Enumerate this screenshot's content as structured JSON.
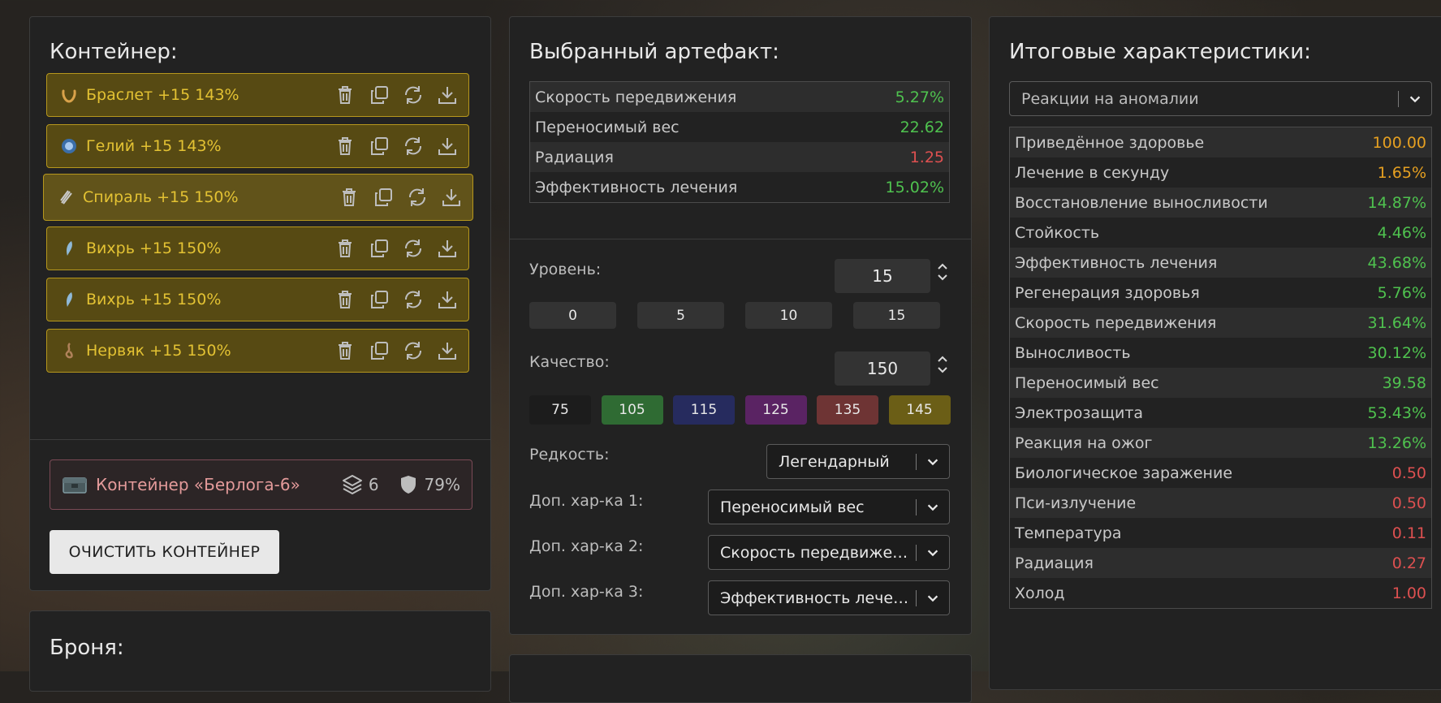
{
  "container_panel": {
    "title": "Контейнер:",
    "artifacts": [
      {
        "name": "Браслет +15 143%",
        "icon": "bracelet-artifact-icon"
      },
      {
        "name": "Гелий +15 143%",
        "icon": "helium-artifact-icon"
      },
      {
        "name": "Спираль +15 150%",
        "icon": "spiral-artifact-icon"
      },
      {
        "name": "Вихрь +15 150%",
        "icon": "vortex-artifact-icon"
      },
      {
        "name": "Вихрь +15 150%",
        "icon": "vortex-artifact-icon"
      },
      {
        "name": "Нервяк +15 150%",
        "icon": "nervyak-artifact-icon"
      }
    ],
    "container": {
      "name": "Контейнер «Берлога-6»",
      "slots": "6",
      "protection": "79%"
    },
    "clear_button": "ОЧИСТИТЬ КОНТЕЙНЕР"
  },
  "armor_panel": {
    "title": "Броня:"
  },
  "selected_panel": {
    "title": "Выбранный артефакт:",
    "stats": [
      {
        "name": "Скорость передвижения",
        "value": "5.27%",
        "color": "green"
      },
      {
        "name": "Переносимый вес",
        "value": "22.62",
        "color": "green"
      },
      {
        "name": "Радиация",
        "value": "1.25",
        "color": "red"
      },
      {
        "name": "Эффективность лечения",
        "value": "15.02%",
        "color": "green"
      }
    ],
    "level_label": "Уровень:",
    "level_value": "15",
    "level_presets": [
      "0",
      "5",
      "10",
      "15"
    ],
    "quality_label": "Качество:",
    "quality_value": "150",
    "quality_presets": [
      {
        "label": "75",
        "color": "#1c1c1c"
      },
      {
        "label": "105",
        "color": "#2f6b33"
      },
      {
        "label": "115",
        "color": "#262b5e"
      },
      {
        "label": "125",
        "color": "#5a2363"
      },
      {
        "label": "135",
        "color": "#6e3434"
      },
      {
        "label": "145",
        "color": "#6b5e16"
      }
    ],
    "rarity_label": "Редкость:",
    "rarity_value": "Легендарный",
    "extra1_label": "Доп. хар-ка 1:",
    "extra1_value": "Переносимый вес",
    "extra2_label": "Доп. хар-ка 2:",
    "extra2_value": "Скорость передвижения",
    "extra3_label": "Доп. хар-ка 3:",
    "extra3_value": "Эффективность лечения"
  },
  "totals_panel": {
    "title": "Итоговые характеристики:",
    "filter_value": "Реакции на аномалии",
    "stats": [
      {
        "name": "Приведённое здоровье",
        "value": "100.00",
        "color": "orange"
      },
      {
        "name": "Лечение в секунду",
        "value": "1.65%",
        "color": "orange"
      },
      {
        "name": "Восстановление выносливости",
        "value": "14.87%",
        "color": "green"
      },
      {
        "name": "Стойкость",
        "value": "4.46%",
        "color": "green"
      },
      {
        "name": "Эффективность лечения",
        "value": "43.68%",
        "color": "green"
      },
      {
        "name": "Регенерация здоровья",
        "value": "5.76%",
        "color": "green"
      },
      {
        "name": "Скорость передвижения",
        "value": "31.64%",
        "color": "green"
      },
      {
        "name": "Выносливость",
        "value": "30.12%",
        "color": "green"
      },
      {
        "name": "Переносимый вес",
        "value": "39.58",
        "color": "green"
      },
      {
        "name": "Электрозащита",
        "value": "53.43%",
        "color": "green"
      },
      {
        "name": "Реакция на ожог",
        "value": "13.26%",
        "color": "green"
      },
      {
        "name": "Биологическое заражение",
        "value": "0.50",
        "color": "red"
      },
      {
        "name": "Пси-излучение",
        "value": "0.50",
        "color": "red"
      },
      {
        "name": "Температура",
        "value": "0.11",
        "color": "red"
      },
      {
        "name": "Радиация",
        "value": "0.27",
        "color": "red"
      },
      {
        "name": "Холод",
        "value": "1.00",
        "color": "red"
      }
    ]
  },
  "colors": {
    "green": "#4fc24f",
    "red": "#dd5050",
    "orange": "#e6a021",
    "gold": "#e3c233"
  }
}
